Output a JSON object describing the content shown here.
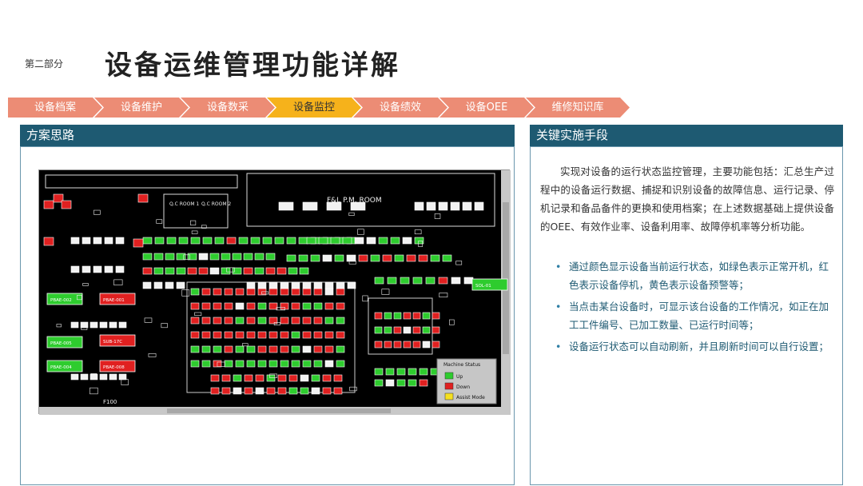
{
  "header": {
    "section_label": "第二部分",
    "title": "设备运维管理功能详解"
  },
  "tabs": [
    {
      "label": "设备档案",
      "active": false
    },
    {
      "label": "设备维护",
      "active": false
    },
    {
      "label": "设备数采",
      "active": false
    },
    {
      "label": "设备监控",
      "active": true
    },
    {
      "label": "设备绩效",
      "active": false
    },
    {
      "label": "设备OEE",
      "active": false
    },
    {
      "label": "维修知识库",
      "active": false
    }
  ],
  "left_panel": {
    "title": "方案思路",
    "floor": {
      "room_label": "F&L P.M. ROOM",
      "qc_room_labels": [
        "Q.C ROOM 1",
        "Q.C ROOM 2"
      ],
      "area_label": "F100",
      "machine_labels": [
        "PBAE-002",
        "PBAE-001",
        "PBAE-005",
        "SUB-17C",
        "PBAE-004",
        "PBAE-008",
        "SOL-01"
      ],
      "legend": {
        "title": "Machine Status",
        "items": [
          {
            "label": "Up",
            "color": "#2ecc2e"
          },
          {
            "label": "Down",
            "color": "#e02020"
          },
          {
            "label": "Assist Mode",
            "color": "#f5e020"
          }
        ]
      }
    }
  },
  "right_panel": {
    "title": "关键实施手段",
    "intro": "实现对设备的运行状态监控管理，主要功能包括：汇总生产过程中的设备运行数据、捕捉和识别设备的故障信息、运行记录、停机记录和备品备件的更换和使用档案；在上述数据基础上提供设备的OEE、有效作业率、设备利用率、故障停机率等分析功能。",
    "bullets": [
      "通过颜色显示设备当前运行状态，如绿色表示正常开机，红色表示设备停机，黄色表示设备预警等；",
      "当点击某台设备时，可显示该台设备的工作情况，如正在加工工件编号、已加工数量、已运行时间等；",
      "设备运行状态可以自动刷新，并且刷新时间可以自行设置；"
    ]
  },
  "colors": {
    "tab": "#ec8c75",
    "tab_active": "#f6b21b",
    "panel_header": "#1e5a72",
    "bullet_text": "#1e5a72"
  }
}
